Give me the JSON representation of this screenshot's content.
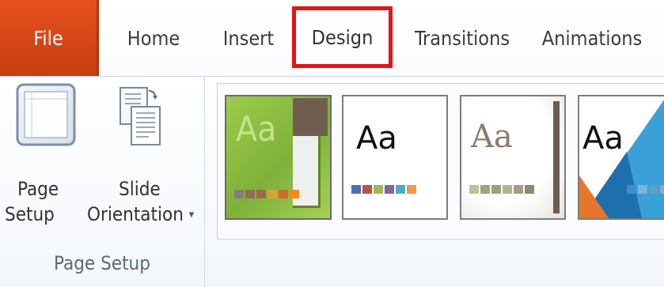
{
  "tabs": {
    "file": "File",
    "home": "Home",
    "insert": "Insert",
    "design": "Design",
    "transitions": "Transitions",
    "animations": "Animations"
  },
  "page_setup_group": {
    "page_setup_btn_line1": "Page",
    "page_setup_btn_line2": "Setup",
    "slide_orientation_btn_line1": "Slide",
    "slide_orientation_btn_line2": "Orientation",
    "dropdown_arrow": "▾",
    "group_label": "Page Setup"
  },
  "themes": [
    {
      "sample": "Aa",
      "swatches": [
        "#7f7f7f",
        "#8c6f56",
        "#9c6a4a",
        "#d5a33a",
        "#d16b2a",
        "#f08a1d"
      ]
    },
    {
      "sample": "Aa",
      "swatches": [
        "#4f6fb8",
        "#c0504d",
        "#9bbb59",
        "#8064a2",
        "#4bacc6",
        "#f79646"
      ]
    },
    {
      "sample": "Aa",
      "swatches": [
        "#bfbf9f",
        "#a3a37f",
        "#9f9f7f",
        "#b2b28c",
        "#a59d83",
        "#8c8c70"
      ]
    },
    {
      "sample": "Aa",
      "swatches": [
        "#3a8fd4",
        "#7fb3d8",
        "#5aa1c8",
        "#8fa9bd"
      ]
    }
  ]
}
